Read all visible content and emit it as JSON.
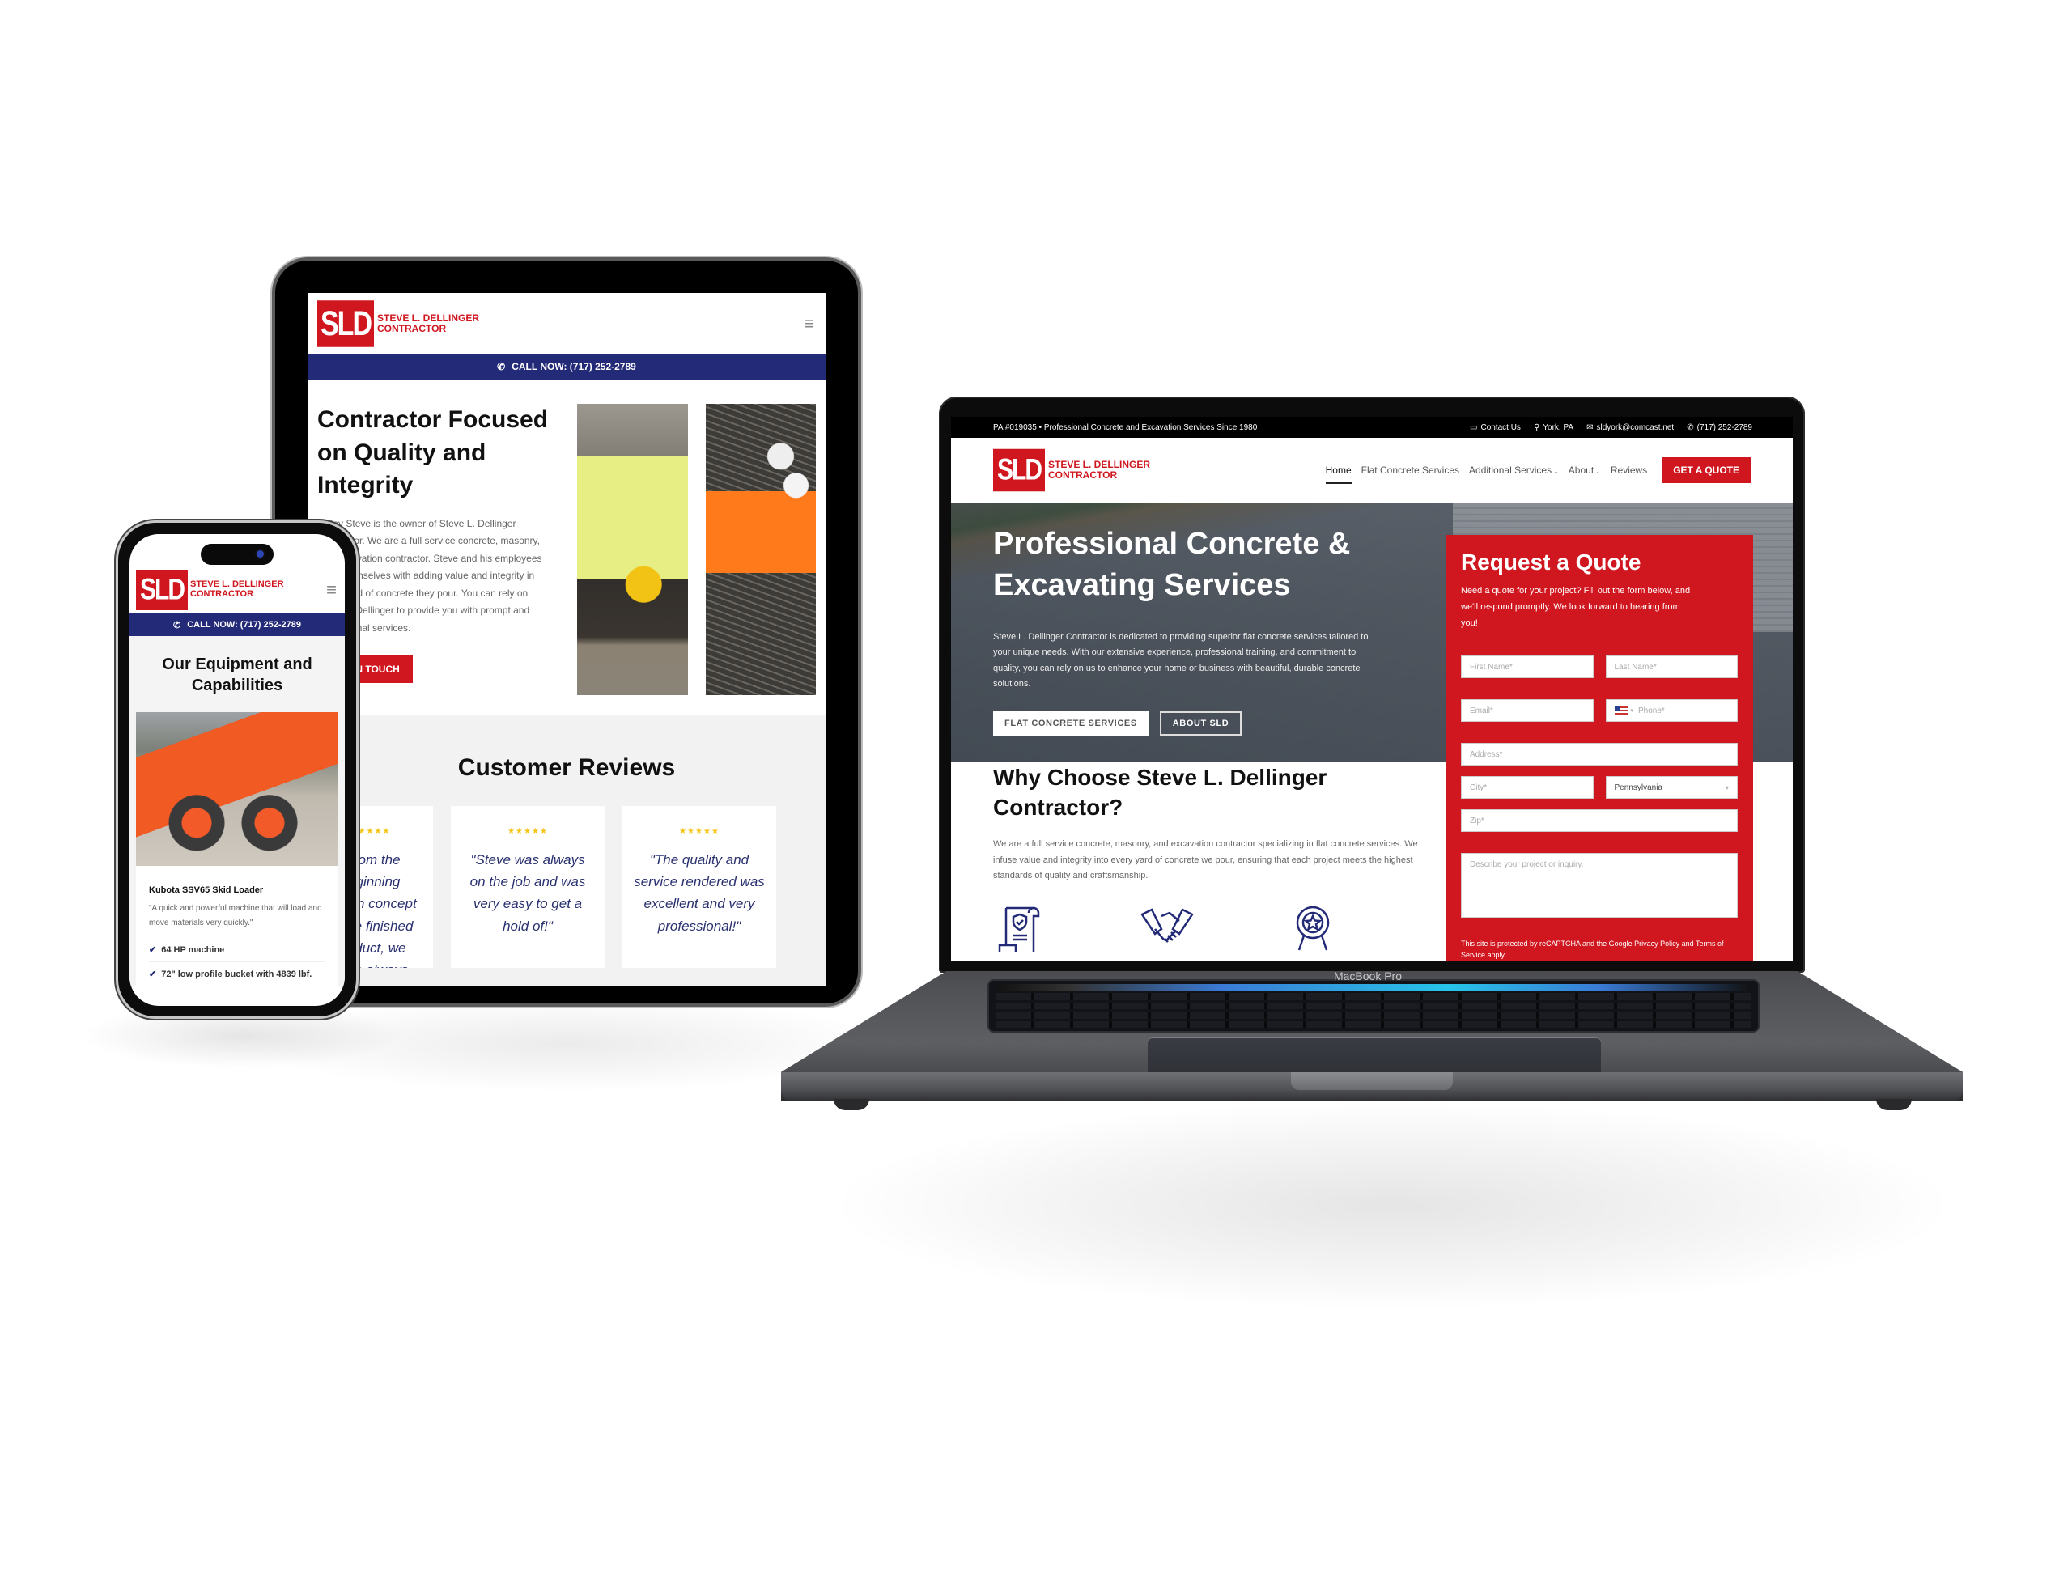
{
  "brand": {
    "logo_initials": "SLD",
    "name_line1": "STEVE L. DELLINGER",
    "name_line2": "CONTRACTOR",
    "accent_red": "#d0161e",
    "navy": "#232a77"
  },
  "laptop": {
    "device_label": "MacBook Pro",
    "topbar": {
      "tagline": "PA #019035 • Professional Concrete and Excavation Services Since 1980",
      "links": [
        {
          "icon": "chat-icon",
          "label": "Contact Us"
        },
        {
          "icon": "map-pin-icon",
          "label": "York, PA"
        },
        {
          "icon": "mail-icon",
          "label": "sldyork@comcast.net"
        },
        {
          "icon": "phone-icon",
          "label": "(717) 252-2789"
        }
      ]
    },
    "nav": {
      "items": [
        {
          "label": "Home",
          "active": true
        },
        {
          "label": "Flat Concrete Services"
        },
        {
          "label": "Additional Services",
          "dropdown": true
        },
        {
          "label": "About",
          "dropdown": true
        },
        {
          "label": "Reviews"
        }
      ],
      "cta": "GET A QUOTE"
    },
    "hero": {
      "title": "Professional Concrete & Excavating Services",
      "body": "Steve L. Dellinger Contractor is dedicated to providing superior flat concrete services tailored to your unique needs. With our extensive experience, professional training, and commitment to quality, you can rely on us to enhance your home or business with beautiful, durable concrete solutions.",
      "primary_button": "FLAT CONCRETE SERVICES",
      "secondary_button": "ABOUT SLD"
    },
    "quote_form": {
      "title": "Request a Quote",
      "intro": "Need a quote for your project? Fill out the form below, and we'll respond promptly. We look forward to hearing from you!",
      "first_name_placeholder": "First Name*",
      "last_name_placeholder": "Last Name*",
      "email_placeholder": "Email*",
      "phone_placeholder": "Phone*",
      "address_placeholder": "Address*",
      "city_placeholder": "City*",
      "state_value": "Pennsylvania",
      "zip_placeholder": "Zip*",
      "message_placeholder": "Describe your project or inquiry.",
      "recaptcha_notice": "This site is protected by reCAPTCHA and the Google Privacy Policy and Terms of Service apply."
    },
    "why": {
      "title": "Why Choose Steve L. Dellinger Contractor?",
      "body": "We are a full service concrete, masonry, and excavation contractor specializing in flat concrete services. We infuse value and integrity into every yard of concrete we pour, ensuring that each project meets the highest standards of quality and craftsmanship.",
      "icons": [
        "certificate-shield-icon",
        "handshake-icon",
        "award-badge-icon"
      ]
    }
  },
  "tablet": {
    "call_bar": "CALL NOW: (717) 252-2789",
    "about": {
      "title": "Contractor Focused on Quality and Integrity",
      "body": "Today Steve is the owner of Steve L. Dellinger Contractor. We are a full service concrete, masonry, and excavation contractor. Steve and his employees pride themselves with adding value and integrity in every yard of concrete they pour. You can rely on Steve L. Dellinger to provide you with prompt and professional services.",
      "button": "GET IN TOUCH"
    },
    "reviews": {
      "title": "Customer Reviews",
      "items": [
        {
          "stars": "★★★★★",
          "rating": 5,
          "quote": "\"From the beginning design concept to the finished product, we have always"
        },
        {
          "stars": "★★★★★",
          "rating": 5,
          "quote": "\"Steve was always on the job and was very easy to get a hold of!\""
        },
        {
          "stars": "★★★★★",
          "rating": 5,
          "quote": "\"The quality and service rendered was excellent and very professional!\""
        }
      ]
    }
  },
  "phone": {
    "call_bar": "CALL NOW: (717) 252-2789",
    "section_title": "Our Equipment and Capabilities",
    "equipment": {
      "name": "Kubota SSV65 Skid Loader",
      "description": "\"A quick and powerful machine that will load and move materials very quickly.\"",
      "features": [
        "64 HP machine",
        "72\" low profile bucket with 4839 lbf."
      ]
    }
  }
}
